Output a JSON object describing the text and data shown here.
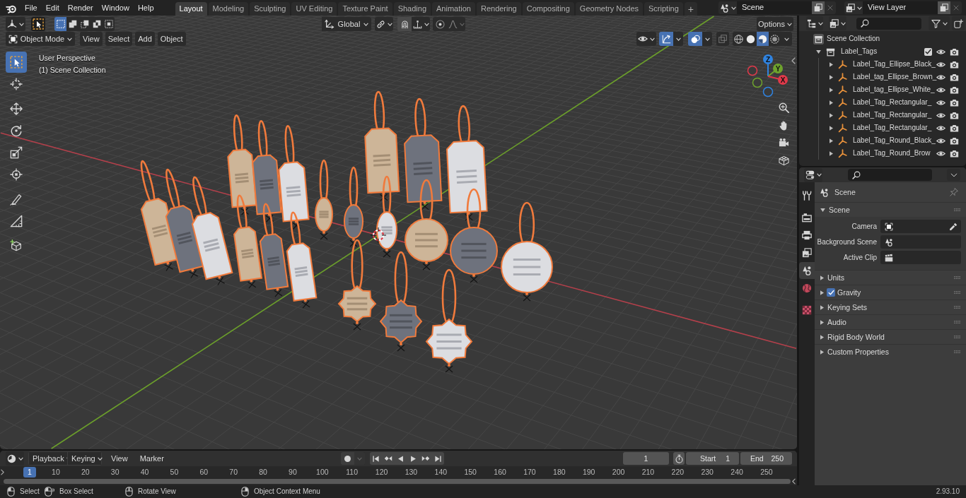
{
  "top_bar": {
    "menus": [
      "File",
      "Edit",
      "Render",
      "Window",
      "Help"
    ],
    "workspaces": [
      {
        "label": "Layout",
        "selected": true
      },
      {
        "label": "Modeling",
        "selected": false
      },
      {
        "label": "Sculpting",
        "selected": false
      },
      {
        "label": "UV Editing",
        "selected": false
      },
      {
        "label": "Texture Paint",
        "selected": false
      },
      {
        "label": "Shading",
        "selected": false
      },
      {
        "label": "Animation",
        "selected": false
      },
      {
        "label": "Rendering",
        "selected": false
      },
      {
        "label": "Compositing",
        "selected": false
      },
      {
        "label": "Geometry Nodes",
        "selected": false
      },
      {
        "label": "Scripting",
        "selected": false
      }
    ],
    "add_workspace": "+",
    "scene": "Scene",
    "view_layer": "View Layer"
  },
  "viewport": {
    "select_modes": [
      {
        "kind": "set",
        "selected": true
      },
      {
        "kind": "extend",
        "selected": false
      },
      {
        "kind": "subtract",
        "selected": false
      },
      {
        "kind": "invert",
        "selected": false
      },
      {
        "kind": "intersect",
        "selected": false
      }
    ],
    "orientation": "Global",
    "options": "Options",
    "mode": "Object Mode",
    "menus": [
      "View",
      "Select",
      "Add",
      "Object"
    ],
    "gizmos_on": true,
    "overlays_on": true,
    "xray_on": false,
    "shading": [
      {
        "kind": "wireframe",
        "selected": false
      },
      {
        "kind": "solid",
        "selected": false
      },
      {
        "kind": "material",
        "selected": true
      },
      {
        "kind": "rendered",
        "selected": false
      }
    ],
    "info": [
      "User Perspective",
      "(1) Scene Collection"
    ],
    "tool_groups": [
      [
        {
          "kind": "select",
          "selected": true
        },
        {
          "kind": "cursor",
          "selected": false
        }
      ],
      [
        {
          "kind": "move",
          "selected": false
        },
        {
          "kind": "rotate",
          "selected": false
        },
        {
          "kind": "scale",
          "selected": false
        },
        {
          "kind": "transform",
          "selected": false
        }
      ],
      [
        {
          "kind": "annotate",
          "selected": false
        },
        {
          "kind": "measure",
          "selected": false
        }
      ],
      [
        {
          "kind": "add-cube",
          "selected": false
        }
      ]
    ],
    "axes": [
      "Z",
      "Y",
      "X"
    ]
  },
  "outliner": {
    "root": "Scene Collection",
    "collection": {
      "name": "Label_Tags",
      "expanded": true,
      "checked": true,
      "children": [
        {
          "name": "Label_Tag_Ellipse_Black_",
          "expanded": false
        },
        {
          "name": "Label_tag_Ellipse_Brown_",
          "expanded": false
        },
        {
          "name": "Label_tag_Ellipse_White_",
          "expanded": false
        },
        {
          "name": "Label_Tag_Rectangular_",
          "expanded": false
        },
        {
          "name": "Label_Tag_Rectangular_",
          "expanded": false
        },
        {
          "name": "Label_Tag_Rectangular_",
          "expanded": false
        },
        {
          "name": "Label_Tag_Round_Black_",
          "expanded": false
        },
        {
          "name": "Label_Tag_Round_Brow",
          "expanded": false
        }
      ]
    }
  },
  "properties": {
    "tab_groups": [
      [
        {
          "kind": "tool",
          "selected": false
        }
      ],
      [
        {
          "kind": "render",
          "selected": false
        },
        {
          "kind": "output",
          "selected": false
        },
        {
          "kind": "view-layer",
          "selected": false
        },
        {
          "kind": "scene",
          "selected": true
        },
        {
          "kind": "world",
          "selected": false
        }
      ],
      [
        {
          "kind": "texture",
          "selected": false
        }
      ]
    ],
    "context": "Scene",
    "panel": {
      "title": "Scene",
      "expanded": true,
      "fields": [
        {
          "label": "Camera",
          "kind": "camera"
        },
        {
          "label": "Background Scene",
          "kind": "scene"
        },
        {
          "label": "Active Clip",
          "kind": "clip"
        }
      ]
    },
    "sections": [
      {
        "title": "Units",
        "expanded": false
      },
      {
        "title": "Gravity",
        "expanded": false,
        "checked": true
      },
      {
        "title": "Keying Sets",
        "expanded": false
      },
      {
        "title": "Audio",
        "expanded": false
      },
      {
        "title": "Rigid Body World",
        "expanded": false
      },
      {
        "title": "Custom Properties",
        "expanded": false
      }
    ]
  },
  "timeline": {
    "menus": [
      {
        "label": "Playback",
        "dropdown": true
      },
      {
        "label": "Keying",
        "dropdown": true
      },
      {
        "label": "View",
        "dropdown": false
      },
      {
        "label": "Marker",
        "dropdown": false
      }
    ],
    "current_frame": "1",
    "start_label": "Start",
    "start": "1",
    "end_label": "End",
    "end": "250",
    "playhead": "1",
    "ruler": [
      "10",
      "20",
      "30",
      "40",
      "50",
      "60",
      "70",
      "80",
      "90",
      "100",
      "110",
      "120",
      "130",
      "140",
      "150",
      "160",
      "170",
      "180",
      "190",
      "200",
      "210",
      "220",
      "230",
      "240",
      "250"
    ]
  },
  "status_bar": {
    "hints": [
      {
        "kind": "click",
        "label": "Select"
      },
      {
        "kind": "drag",
        "label": "Box Select"
      },
      {
        "kind": "middle",
        "label": "Rotate View"
      },
      {
        "kind": "right",
        "label": "Object Context Menu"
      }
    ],
    "version": "2.93.10"
  }
}
